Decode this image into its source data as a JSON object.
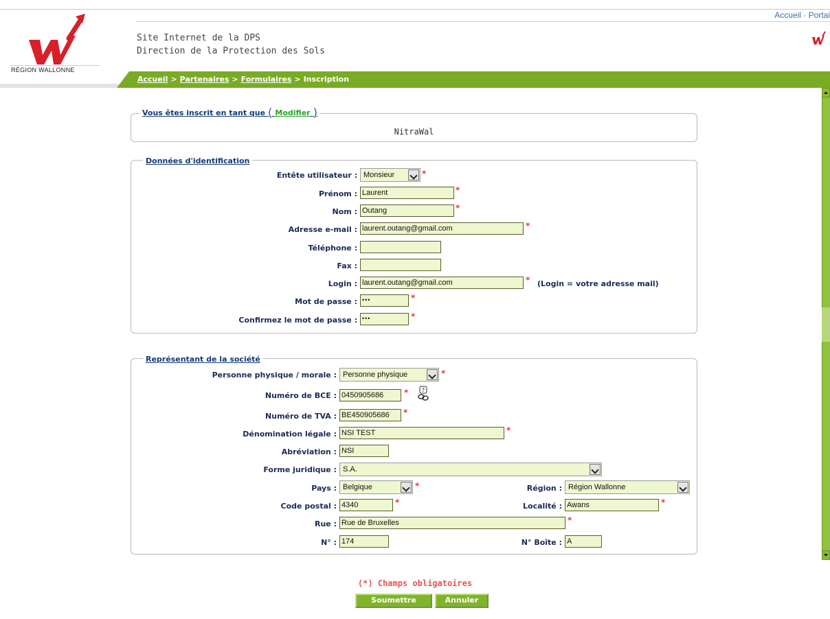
{
  "header": {
    "top_links": [
      "Accueil",
      "Portai"
    ],
    "logo_caption": "RÉGION WALLONNE",
    "site_title_1": "Site Internet de la DPS",
    "site_title_2": "Direction de la Protection des Sols"
  },
  "breadcrumb": {
    "items": [
      "Accueil",
      "Partenaires",
      "Formulaires"
    ],
    "current": "Inscription",
    "separator": ">"
  },
  "registration": {
    "legend_text": "Vous êtes inscrit en tant que",
    "modify_label": "Modifier",
    "value": "NitraWal"
  },
  "identification": {
    "legend": "Données d'identification",
    "title_label": "Entête utilisateur :",
    "title_value": "Monsieur",
    "firstname_label": "Prénom :",
    "firstname_value": "Laurent",
    "lastname_label": "Nom :",
    "lastname_value": "Outang",
    "email_label": "Adresse e-mail :",
    "email_value": "laurent.outang@gmail.com",
    "phone_label": "Téléphone :",
    "phone_value": "",
    "fax_label": "Fax :",
    "fax_value": "",
    "login_label": "Login :",
    "login_value": "laurent.outang@gmail.com",
    "login_note": "(Login = votre adresse mail)",
    "password_label": "Mot de passe :",
    "password_value": "•••",
    "confirm_label": "Confirmez le mot de passe :",
    "confirm_value": "•••"
  },
  "company": {
    "legend": "Représentant de la société",
    "person_label": "Personne physique / morale :",
    "person_value": "Personne physique",
    "bce_label": "Numéro de BCE :",
    "bce_value": "0450905686",
    "tva_label": "Numéro de TVA :",
    "tva_value": "BE450905686",
    "legal_label": "Dénomination légale :",
    "legal_value": "NSI TEST",
    "abbr_label": "Abréviation :",
    "abbr_value": "NSI",
    "form_label": "Forme juridique :",
    "form_value": "S.A.",
    "country_label": "Pays :",
    "country_value": "Belgique",
    "region_label": "Région :",
    "region_value": "Région Wallonne",
    "postal_label": "Code postal :",
    "postal_value": "4340",
    "city_label": "Localité :",
    "city_value": "Awans",
    "street_label": "Rue :",
    "street_value": "Rue de Bruxelles",
    "number_label": "N° :",
    "number_value": "174",
    "box_label": "N° Boîte :",
    "box_value": "A"
  },
  "footer": {
    "mandatory_text": "(*) Champs obligatoires",
    "submit_label": "Soumettre",
    "cancel_label": "Annuler"
  },
  "required_marker": "*",
  "colors": {
    "nav_green": "#7aab25",
    "field_bg": "#eef7cf",
    "label_blue": "#1a2a55",
    "required_red": "#e53b3b",
    "logo_red": "#d8202b"
  }
}
